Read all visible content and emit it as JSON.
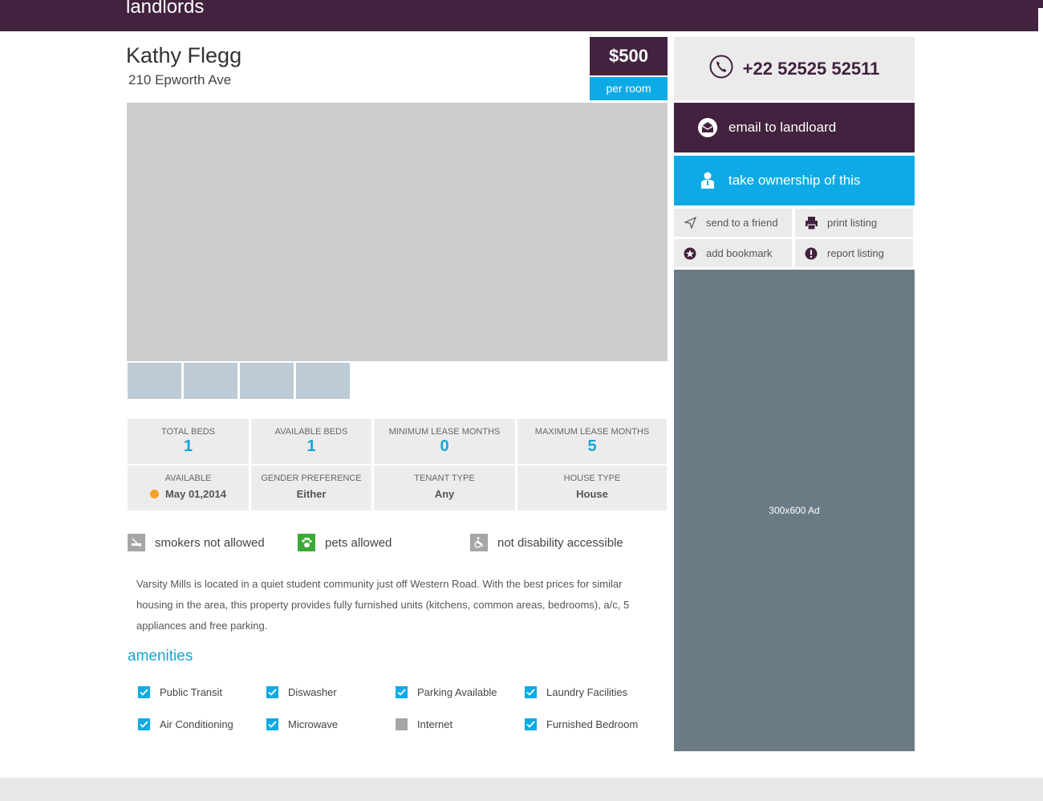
{
  "header": {
    "brand": "landlords"
  },
  "listing": {
    "title": "Kathy Flegg",
    "address": "210 Epworth Ave",
    "price": "$500",
    "price_unit": "per room",
    "description": "Varsity Mills is located in a quiet student community just off Western Road. With the best prices for similar housing in the area, this property provides fully furnished units (kitchens, common areas, bedrooms), a/c, 5 appliances and free parking."
  },
  "stats": {
    "total_beds": {
      "label": "TOTAL BEDS",
      "value": "1"
    },
    "available_beds": {
      "label": "AVAILABLE BEDS",
      "value": "1"
    },
    "min_lease": {
      "label": "MINIMUM LEASE MONTHS",
      "value": "0"
    },
    "max_lease": {
      "label": "MAXIMUM LEASE MONTHS",
      "value": "5"
    },
    "available": {
      "label": "AVAILABLE",
      "value": "May 01,2014"
    },
    "gender": {
      "label": "GENDER PREFERENCE",
      "value": "Either"
    },
    "tenant": {
      "label": "TENANT TYPE",
      "value": "Any"
    },
    "house": {
      "label": "HOUSE TYPE",
      "value": "House"
    }
  },
  "features": [
    {
      "label": "smokers not allowed",
      "icon": "no-smoking-icon",
      "color": "#a6a6a6"
    },
    {
      "label": "pets allowed",
      "icon": "paw-icon",
      "color": "#3aaa35"
    },
    {
      "label": "not disability accessible",
      "icon": "wheelchair-icon",
      "color": "#a6a6a6"
    }
  ],
  "amenities": {
    "heading": "amenities",
    "items": [
      {
        "label": "Public Transit",
        "checked": true
      },
      {
        "label": "Diswasher",
        "checked": true
      },
      {
        "label": "Parking Available",
        "checked": true
      },
      {
        "label": "Laundry Facilities",
        "checked": true
      },
      {
        "label": "Air Conditioning",
        "checked": true
      },
      {
        "label": "Microwave",
        "checked": true
      },
      {
        "label": "Internet",
        "checked": false
      },
      {
        "label": "Furnished Bedroom",
        "checked": true
      }
    ]
  },
  "sidebar": {
    "phone": "+22 52525 52511",
    "email_label": "email to landloard",
    "ownership_label": "take ownership of this",
    "send_label": "send to a friend",
    "print_label": "print listing",
    "bookmark_label": "add bookmark",
    "report_label": "report listing",
    "ad_label": "300x600 Ad"
  },
  "colors": {
    "brand": "#42223e",
    "accent": "#0eaae6",
    "available_dot": "#f4a32a"
  }
}
